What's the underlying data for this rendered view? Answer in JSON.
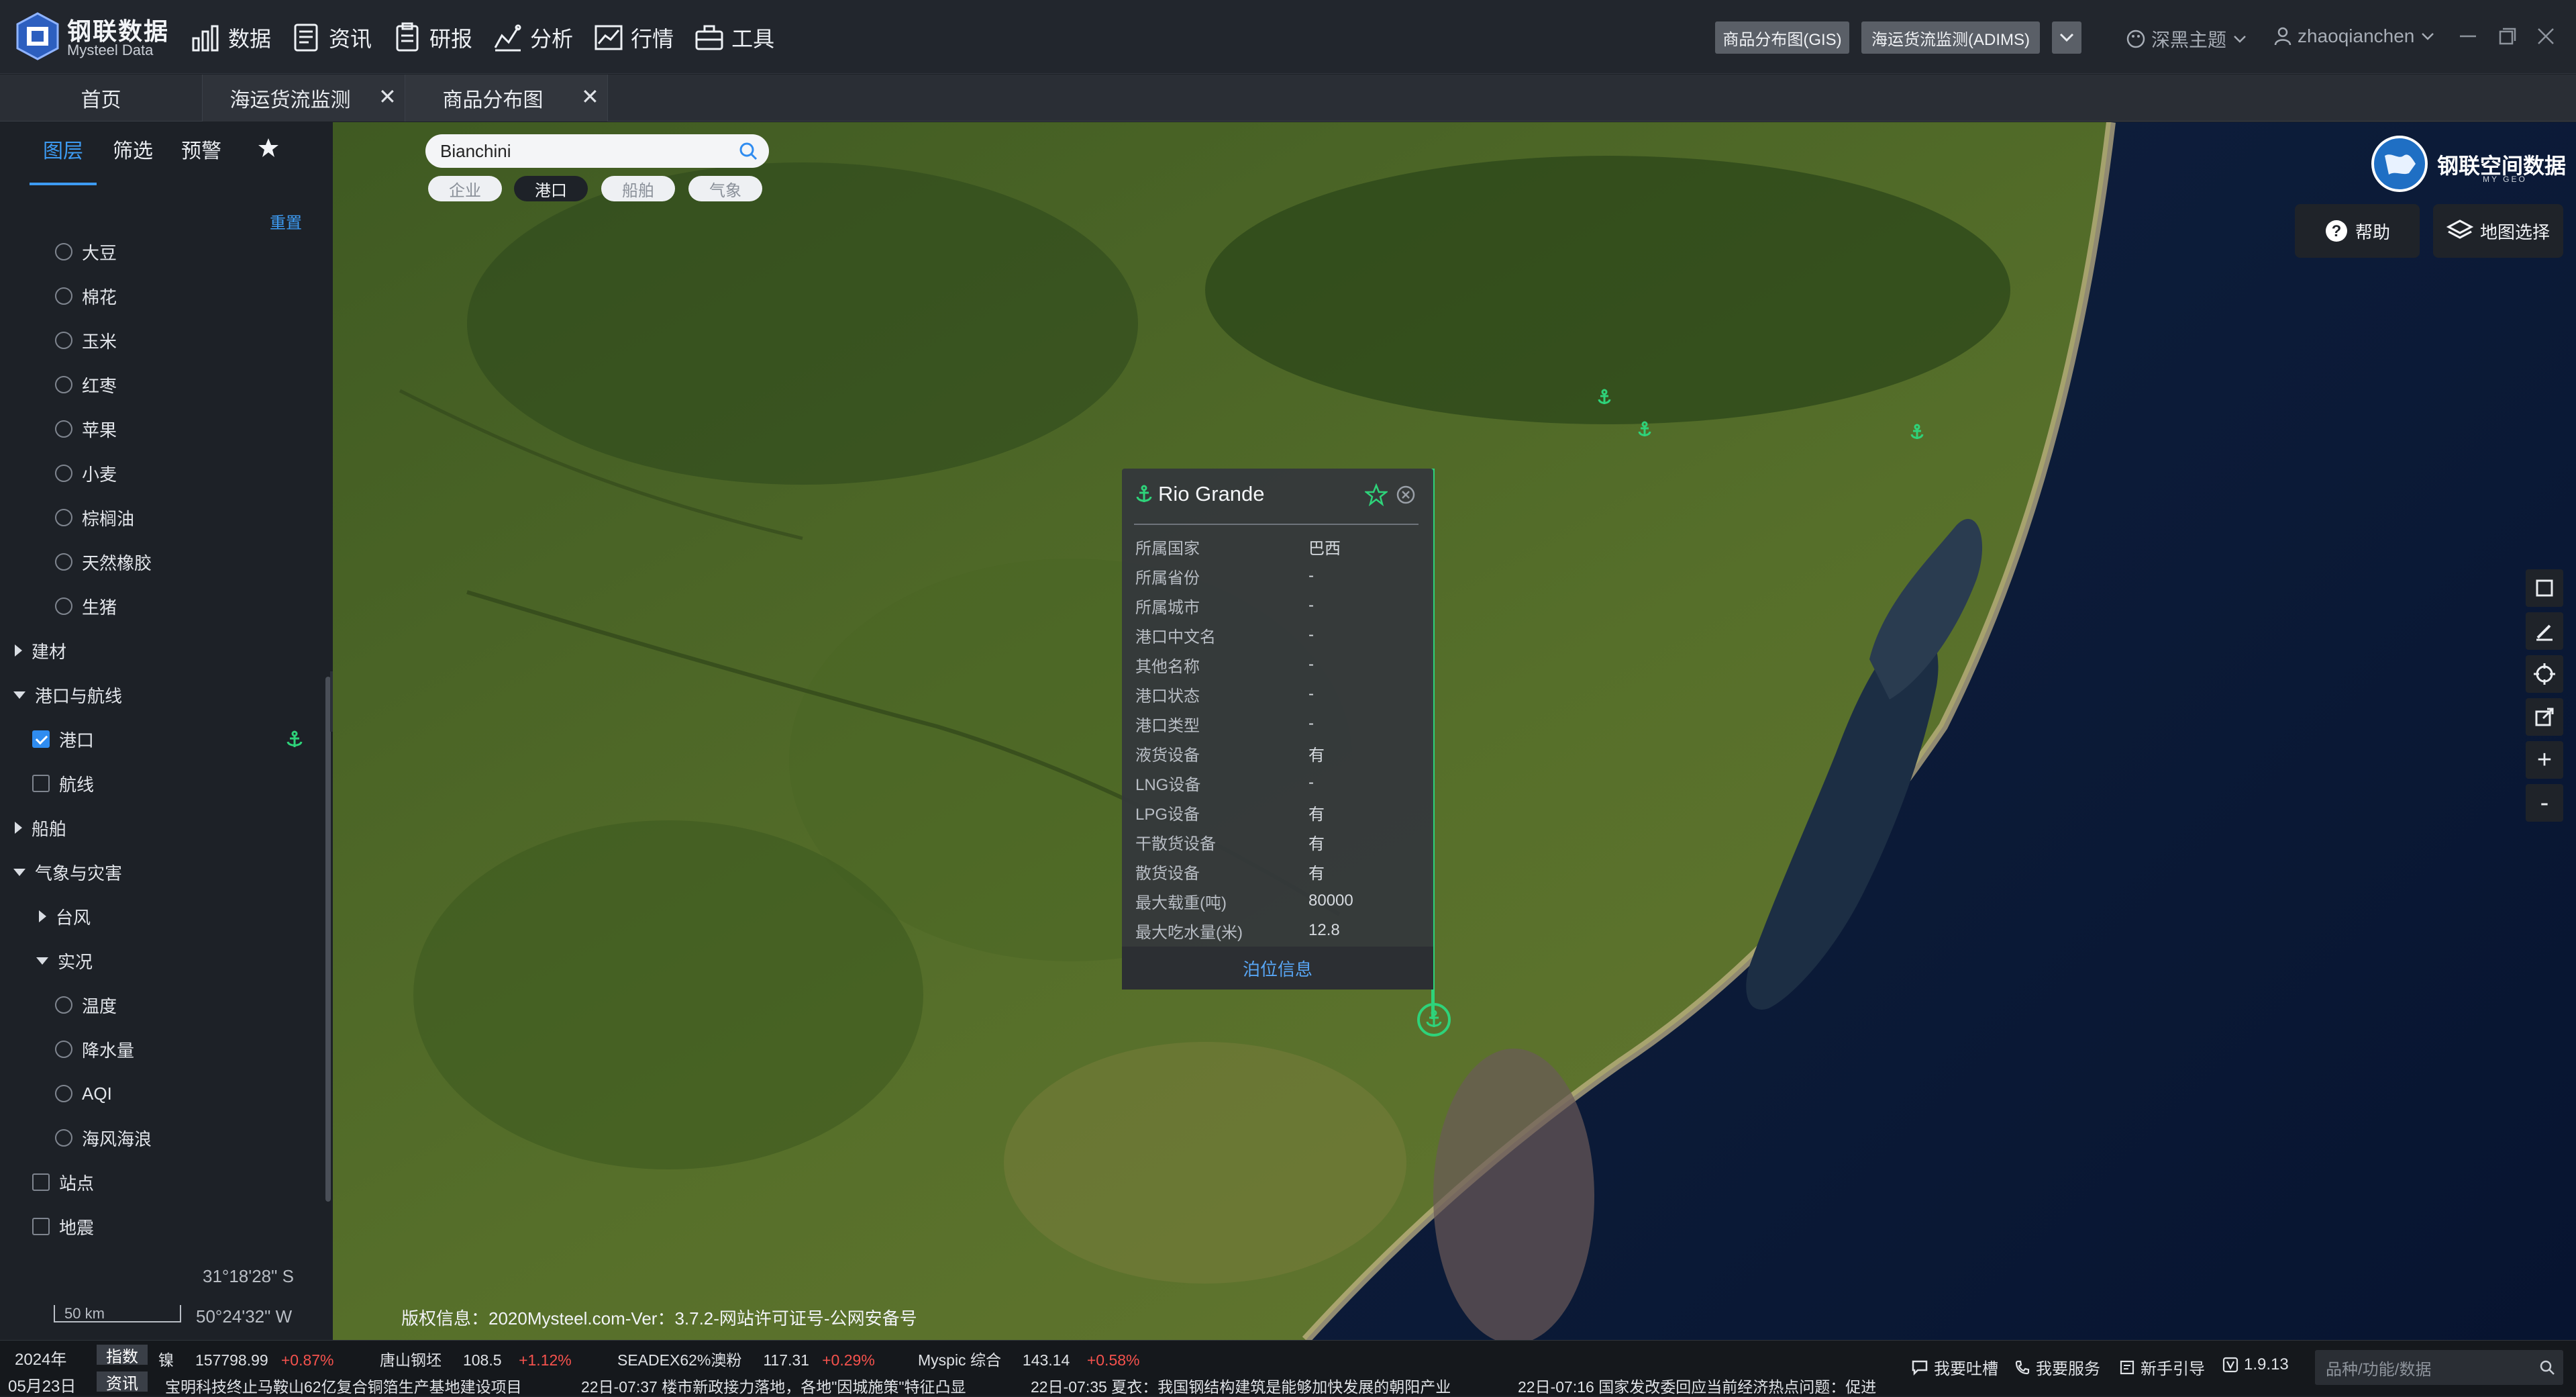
{
  "app": {
    "brand_main": "钢联数据",
    "brand_sub": "Mysteel Data",
    "nav": [
      "数据",
      "资讯",
      "研报",
      "分析",
      "行情",
      "工具"
    ],
    "pill_gis": "商品分布图(GIS)",
    "pill_adims": "海运货流监测(ADIMS)",
    "theme": "深黑主题",
    "user": "zhaoqianchen"
  },
  "tabs": [
    {
      "label": "首页"
    },
    {
      "label": "海运货流监测"
    },
    {
      "label": "商品分布图"
    }
  ],
  "sidebar": {
    "tabs": [
      "图层",
      "筛选",
      "预警"
    ],
    "reset": "重置",
    "items": [
      {
        "label": "大豆"
      },
      {
        "label": "棉花"
      },
      {
        "label": "玉米"
      },
      {
        "label": "红枣"
      },
      {
        "label": "苹果"
      },
      {
        "label": "小麦"
      },
      {
        "label": "棕榈油"
      },
      {
        "label": "天然橡胶"
      },
      {
        "label": "生猪"
      },
      {
        "label": "建材"
      },
      {
        "label": "港口与航线"
      },
      {
        "label": "港口"
      },
      {
        "label": "航线"
      },
      {
        "label": "船舶"
      },
      {
        "label": "气象与灾害"
      },
      {
        "label": "台风"
      },
      {
        "label": "实况"
      },
      {
        "label": "温度"
      },
      {
        "label": "降水量"
      },
      {
        "label": "AQI"
      },
      {
        "label": "海风海浪"
      },
      {
        "label": "站点"
      },
      {
        "label": "地震"
      }
    ]
  },
  "map": {
    "search_value": "Bianchini",
    "filters": [
      "企业",
      "港口",
      "船舶",
      "气象"
    ],
    "geo_brand": "钢联空间数据",
    "geo_sub": "MY GEO",
    "help": "帮助",
    "map_select": "地图选择",
    "zoom_in": "+",
    "zoom_out": "-",
    "coord_lat": "31°18'28\" S",
    "coord_lon": "50°24'32\" W",
    "scale": "50 km",
    "copyright": "版权信息：2020Mysteel.com-Ver：3.7.2-网站许可证号-公网安备号"
  },
  "popup": {
    "title": "Rio Grande",
    "rows": [
      {
        "key": "所属国家",
        "val": "巴西"
      },
      {
        "key": "所属省份",
        "val": "-"
      },
      {
        "key": "所属城市",
        "val": "-"
      },
      {
        "key": "港口中文名",
        "val": "-"
      },
      {
        "key": "其他名称",
        "val": "-"
      },
      {
        "key": "港口状态",
        "val": "-"
      },
      {
        "key": "港口类型",
        "val": "-"
      },
      {
        "key": "液货设备",
        "val": "有"
      },
      {
        "key": "LNG设备",
        "val": "-"
      },
      {
        "key": "LPG设备",
        "val": "有"
      },
      {
        "key": "干散货设备",
        "val": "有"
      },
      {
        "key": "散货设备",
        "val": "有"
      },
      {
        "key": "最大载重(吨)",
        "val": "80000"
      },
      {
        "key": "最大吃水量(米)",
        "val": "12.8"
      }
    ],
    "footer": "泊位信息"
  },
  "ticker": {
    "year": "2024年",
    "date": "05月23日",
    "tag_index": "指数",
    "tag_news": "资讯",
    "quotes": [
      {
        "name": "镍",
        "value": "157798.99",
        "change": "+0.87%"
      },
      {
        "name": "唐山钢坯",
        "value": "108.5",
        "change": "+1.12%"
      },
      {
        "name": "SEADEX62%澳粉",
        "value": "117.31",
        "change": "+0.29%"
      },
      {
        "name": "Myspic 综合",
        "value": "143.14",
        "change": "+0.58%"
      }
    ],
    "news": [
      "宝明科技终止马鞍山62亿复合铜箔生产基地建设项目",
      "22日-07:37  楼市新政接力落地，各地\"因城施策\"特征凸显",
      "22日-07:35  夏衣：我国钢结构建筑是能够加快发展的朝阳产业",
      "22日-07:16  国家发改委回应当前经济热点问题：促进"
    ],
    "links": [
      "我要吐槽",
      "我要服务",
      "新手引导"
    ],
    "version": "1.9.13",
    "search_placeholder": "品种/功能/数据"
  },
  "colors": {
    "accent": "#3d9bf2",
    "port_green": "#2ed37a",
    "up_red": "#f5524d"
  }
}
